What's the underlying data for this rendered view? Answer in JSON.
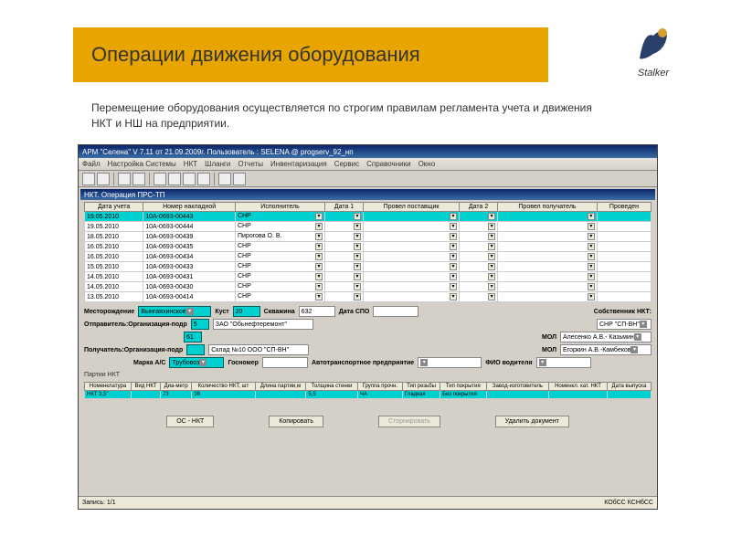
{
  "slide": {
    "title": "Операции движения оборудования",
    "intro": "Перемещение оборудования осуществляется по строгим правилам регламента учета и движения НКТ и НШ на предприятии.",
    "logo_text": "Stalker"
  },
  "app": {
    "title": "АРМ \"Селена\" V 7.11 от 21.09.2009г.  Пользователь : SELENA @ progserv_92_нп",
    "menu": [
      "Файл",
      "Настройка Системы",
      "НКТ",
      "Шланги",
      "Отчеты",
      "Инвентаризация",
      "Сервис",
      "Справочники",
      "Окно"
    ],
    "subtitle": "НКТ. Операция ПРС-ТП"
  },
  "cols": [
    "Дата учета",
    "Номер накладной",
    "Исполнитель",
    "Дата 1",
    "Провел поставщик",
    "Дата 2",
    "Провел получатель",
    "Проведен"
  ],
  "rows": [
    {
      "d": "19.05.2010",
      "n": "10А-0693-00443",
      "i": "СНР"
    },
    {
      "d": "19.05.2010",
      "n": "10А-0693-00444",
      "i": "СНР"
    },
    {
      "d": "18.05.2010",
      "n": "10А-0693-00439",
      "i": "Пирогова О. В."
    },
    {
      "d": "16.05.2010",
      "n": "10А-0693-00435",
      "i": "СНР"
    },
    {
      "d": "16.05.2010",
      "n": "10А-0693-00434",
      "i": "СНР"
    },
    {
      "d": "15.05.2010",
      "n": "10А-0693-00433",
      "i": "СНР"
    },
    {
      "d": "14.05.2010",
      "n": "10А-0693-00431",
      "i": "СНР"
    },
    {
      "d": "14.05.2010",
      "n": "10А-0693-00430",
      "i": "СНР"
    },
    {
      "d": "13.05.2010",
      "n": "10А-0693-00414",
      "i": "СНР"
    }
  ],
  "form": {
    "mesto_l": "Месторождение",
    "mesto_v": "Вынгаяхинское",
    "kust_l": "Куст",
    "kust_v": "20",
    "skv_l": "Скважина",
    "skv_v": "632",
    "spo_l": "Дата СПО",
    "sobstv_l": "Собственник НКТ:",
    "sobstv_v": "СНР \"СП-ВН\"",
    "otprav_l": "Отправитель:Организация-подр",
    "otprav_v1": "5",
    "otprav_v2": "61",
    "org1": "ЗАО \"Обьнефтеремонт\"",
    "mol1_l": "МОЛ",
    "mol1_v": "Алесенко А.В.- Казьмин",
    "poluch_l": "Получатель:Организация-подр",
    "org2": "Склад №10 ООО \"СП-ВН\"",
    "mol2_l": "МОЛ",
    "mol2_v": "Егоркин А.В.-Камбеков",
    "marka_l": "Марка А/С",
    "marka_v": "Трубовоз",
    "gos_l": "Госномер",
    "atp_l": "Автотранспортное предприятие",
    "fio_l": "ФИО водителя",
    "group_l": "Партии НКТ"
  },
  "dcols": [
    "Номенклатура",
    "Вид НКТ",
    "Диа-метр",
    "Количество НКТ, шт",
    "Длина партии,м",
    "Толщина стенки",
    "Группа прочн.",
    "Тип резьбы",
    "Тип покрытия",
    "Завод-изготовитель",
    "Номенкл. кат. НКТ",
    "Дата выпуска"
  ],
  "drow": {
    "nom": "НКТ 3,5\"",
    "vid": "",
    "dia": "73",
    "kol": "36",
    "dl": "",
    "tol": "5,5",
    "gr": "ЧА",
    "res": "Гладкая",
    "pok": "Без покрытия",
    "zav": "",
    "kat": "",
    "dat": ""
  },
  "btns": {
    "oc": "ОС - НКТ",
    "copy": "Копировать",
    "storno": "Сторнировать",
    "del": "Удалить документ"
  },
  "status": {
    "rec": "Запись: 1/1",
    "kb": "КОбСС  КСНбСС"
  }
}
